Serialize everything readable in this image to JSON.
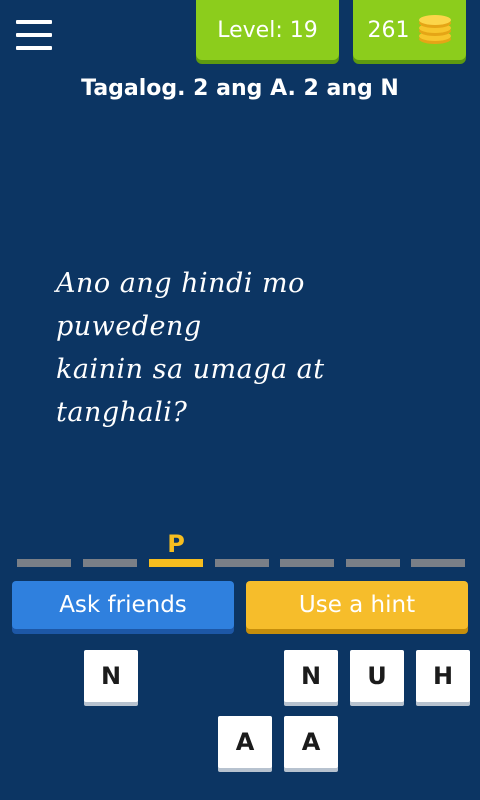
{
  "header": {
    "menu_icon": "hamburger-menu-icon",
    "level_text": "Level: 19",
    "coins": "261",
    "coins_icon": "coin-stack-icon"
  },
  "category": "Tagalog. 2 ang A. 2 ang N",
  "riddle": {
    "line1": "Ano ang hindi mo puwedeng",
    "line2": "kainin sa umaga at tanghali?"
  },
  "answer_slots": [
    "",
    "",
    "P",
    "",
    "",
    "",
    ""
  ],
  "buttons": {
    "ask_friends": "Ask friends",
    "use_hint": "Use a hint"
  },
  "tiles": {
    "row1": [
      "N",
      "",
      "",
      "N",
      "U",
      "H"
    ],
    "row2": [
      "",
      "",
      "A",
      "A",
      "",
      ""
    ]
  },
  "colors": {
    "background": "#0c3563",
    "green": "#8ccd1c",
    "blue": "#2f80de",
    "yellow": "#f6bd2b",
    "slot_gray": "#7a7f87"
  }
}
